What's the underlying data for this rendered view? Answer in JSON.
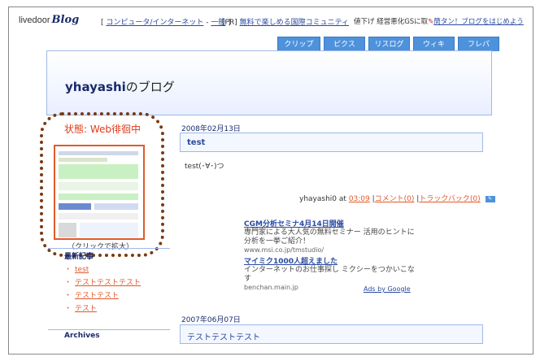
{
  "topbar": {
    "logo_prefix": "livedoor",
    "logo_blog": "Blog",
    "category_open": "[",
    "category": "コンピュータ/インターネット",
    "category_sep": " - ",
    "category_sub": "一般",
    "category_close": "]",
    "pr_label": "[PR]",
    "pr_link": "無料で楽しめる国際コミュニティ",
    "ticker_prefix": "値下げ 経営悪化GSに取",
    "ticker_link": "簡タン！ブログをはじめよう"
  },
  "tabs": [
    "クリップ",
    "ピクス",
    "リスログ",
    "ウィキ",
    "フレパ"
  ],
  "header": {
    "owner": "yhayashi",
    "suffix": "のブログ"
  },
  "sidebar": {
    "status": "状態: Web徘徊中",
    "thumb_caption": "（クリックで拡大）",
    "recent_title": "最新記事",
    "recent_items": [
      "test",
      "テストテストテスト",
      "テストテスト",
      "テスト"
    ],
    "archives_title": "Archives"
  },
  "entry1": {
    "date": "2008年02月13日",
    "title": "test",
    "body": "test(･∀･)つ",
    "author": "yhayashi0",
    "at": "at",
    "time": "03:09",
    "comments": "コメント(0)",
    "trackback": "トラックバック(0)",
    "icon_label": "edit"
  },
  "ads": [
    {
      "title": "CGM分析セミナ4月14日開催",
      "desc": "専門家による大人気の無料セミナー 活用のヒントに分析を一挙ご紹介！",
      "url": "www.msi.co.jp/tmstudio/"
    },
    {
      "title": "マイミク1000人超えました",
      "desc": "インターネットのお仕事探し ミクシーをつかいこなす",
      "url": "benchan.main.jp"
    }
  ],
  "ads_by": "Ads by Google",
  "entry2": {
    "date": "2007年06月07日",
    "title": "テストテストテスト"
  },
  "colors": {
    "accent": "#4e92dc",
    "status_red": "#e03a1a",
    "link_orange": "#e05a2a",
    "circle_brown": "#7a3a12"
  }
}
